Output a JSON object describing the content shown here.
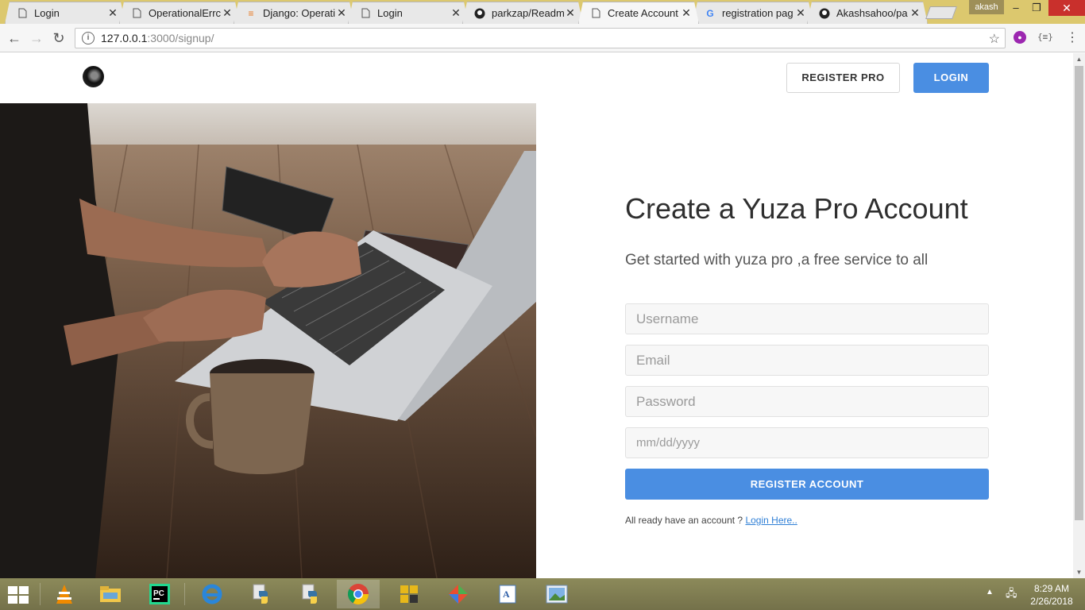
{
  "browser": {
    "tabs": [
      {
        "title": "Login",
        "icon": "page-icon",
        "active": false
      },
      {
        "title": "OperationalErrc",
        "icon": "page-icon",
        "active": false
      },
      {
        "title": "Django: Operati",
        "icon": "stackoverflow-icon",
        "active": false
      },
      {
        "title": "Login",
        "icon": "page-icon",
        "active": false
      },
      {
        "title": "parkzap/Readm",
        "icon": "github-icon",
        "active": false
      },
      {
        "title": "Create Account",
        "icon": "page-icon",
        "active": true
      },
      {
        "title": "registration pag",
        "icon": "google-icon",
        "active": false
      },
      {
        "title": "Akashsahoo/pa",
        "icon": "github-icon",
        "active": false
      }
    ],
    "profile_name": "akash",
    "address_host": "127.0.0.1",
    "address_path": ":3000/signup/"
  },
  "page": {
    "nav": {
      "register_pro_label": "REGISTER PRO",
      "login_label": "LOGIN"
    },
    "title": "Create a Yuza Pro Account",
    "subtitle": "Get started with yuza pro ,a free service to all",
    "form": {
      "username_placeholder": "Username",
      "email_placeholder": "Email",
      "password_placeholder": "Password",
      "date_placeholder": "mm/dd/yyyy",
      "submit_label": "REGISTER ACCOUNT"
    },
    "footer_text": "All ready have an account ?",
    "footer_link": "Login Here.."
  },
  "taskbar": {
    "apps": [
      "vlc-icon",
      "file-explorer-icon",
      "pycharm-icon",
      "internet-explorer-icon",
      "python-icon",
      "python-icon",
      "chrome-icon",
      "puzzle-app-icon",
      "git-icon",
      "wordpad-icon",
      "photos-icon"
    ],
    "time": "8:29 AM",
    "date": "2/26/2018"
  },
  "colors": {
    "primary_button": "#4a8ee2",
    "taskbar": "#7f7c52"
  }
}
